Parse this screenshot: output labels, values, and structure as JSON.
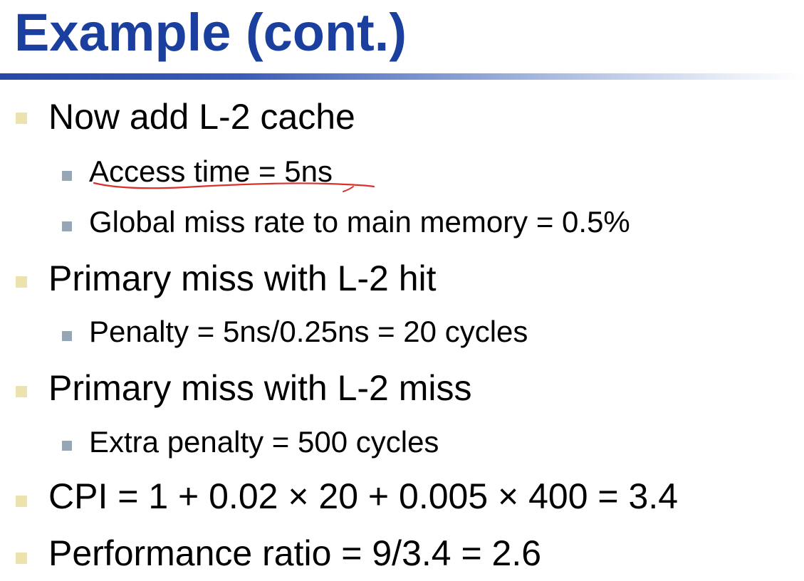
{
  "title": "Example (cont.)",
  "bullets": [
    {
      "text": "Now add L-2 cache",
      "sub": [
        "Access time = 5ns",
        "Global miss rate to main memory = 0.5%"
      ]
    },
    {
      "text": "Primary miss with L-2 hit",
      "sub": [
        "Penalty = 5ns/0.25ns = 20 cycles"
      ]
    },
    {
      "text": "Primary miss with L-2 miss",
      "sub": [
        "Extra penalty = 500 cycles"
      ]
    },
    {
      "text": "CPI = 1 + 0.02 × 20 + 0.005 × 400 = 3.4",
      "sub": []
    },
    {
      "text": "Performance ratio = 9/3.4 = 2.6",
      "sub": []
    }
  ],
  "colors": {
    "title": "#1a3f9e",
    "bullet_level1": "#ece2ae",
    "bullet_level2": "#97a6b7",
    "annotation_ink": "#d8322e"
  }
}
